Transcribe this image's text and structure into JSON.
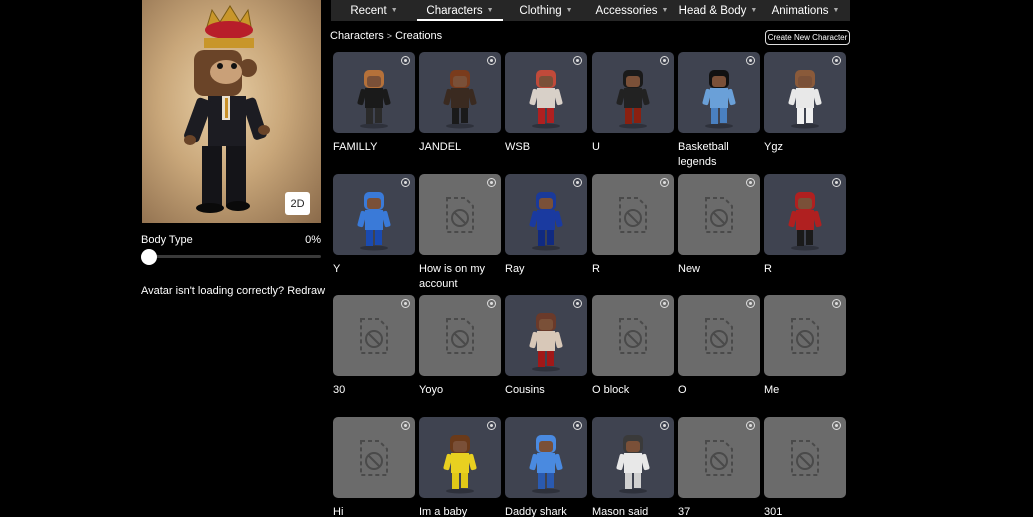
{
  "avatar_panel": {
    "toggle_label": "2D",
    "body_type_label": "Body Type",
    "body_type_value": "0%",
    "body_type_fraction": 0,
    "loading_text": "Avatar isn't loading correctly?",
    "redraw_label": "Redraw"
  },
  "nav": {
    "tabs": [
      {
        "label": "Recent"
      },
      {
        "label": "Characters"
      },
      {
        "label": "Clothing"
      },
      {
        "label": "Accessories"
      },
      {
        "label": "Head & Body"
      },
      {
        "label": "Animations"
      }
    ]
  },
  "breadcrumb": {
    "parent": "Characters",
    "current": "Creations"
  },
  "create_button": "Create New Character",
  "characters": [
    {
      "name": "FAMILLY",
      "thumb": "avatar",
      "hair": "#b5713a",
      "shirt": "#1a1a1a",
      "pants": "#2a2a2a"
    },
    {
      "name": "JANDEL",
      "thumb": "avatar",
      "hair": "#7a3b1c",
      "shirt": "#3a2a20",
      "pants": "#1a1a1a"
    },
    {
      "name": "WSB",
      "thumb": "avatar",
      "hair": "#c04a3a",
      "shirt": "#d8d0c8",
      "pants": "#b02020"
    },
    {
      "name": "U",
      "thumb": "avatar",
      "hair": "#1a1a1a",
      "shirt": "#222222",
      "pants": "#8a2010"
    },
    {
      "name": "Basketball legends",
      "thumb": "avatar",
      "hair": "#111111",
      "shirt": "#6aa0d8",
      "pants": "#4a80c0"
    },
    {
      "name": "Ygz",
      "thumb": "avatar",
      "hair": "#8a5a3a",
      "shirt": "#e8e8e8",
      "pants": "#f0f0f0"
    },
    {
      "name": "Y",
      "thumb": "avatar",
      "hair": "#3a7ad8",
      "shirt": "#3a7ad8",
      "pants": "#1a4ab0"
    },
    {
      "name": "How is on my account",
      "thumb": "empty"
    },
    {
      "name": "Ray",
      "thumb": "avatar",
      "hair": "#1a3a9a",
      "shirt": "#1a3aa0",
      "pants": "#102a80"
    },
    {
      "name": "R",
      "thumb": "empty"
    },
    {
      "name": "New",
      "thumb": "empty"
    },
    {
      "name": "R",
      "thumb": "avatar",
      "hair": "#b02020",
      "shirt": "#b02020",
      "pants": "#1a1a1a"
    },
    {
      "name": "30",
      "thumb": "empty"
    },
    {
      "name": "Yoyo",
      "thumb": "empty"
    },
    {
      "name": "Cousins",
      "thumb": "avatar",
      "hair": "#6a3a2a",
      "shirt": "#d8c8b8",
      "pants": "#a01818"
    },
    {
      "name": "O block",
      "thumb": "empty"
    },
    {
      "name": "O",
      "thumb": "empty"
    },
    {
      "name": "Me",
      "thumb": "empty"
    },
    {
      "name": "Hi",
      "thumb": "empty"
    },
    {
      "name": "Im a baby",
      "thumb": "avatar",
      "hair": "#6a3a1a",
      "shirt": "#e8d020",
      "pants": "#e0c818"
    },
    {
      "name": "Daddy shark",
      "thumb": "avatar",
      "hair": "#4a8ae0",
      "shirt": "#4a8ae0",
      "pants": "#2a5ab0"
    },
    {
      "name": "Mason said",
      "thumb": "avatar",
      "hair": "#3a3a3a",
      "shirt": "#e8e8e8",
      "pants": "#d0d0d0"
    },
    {
      "name": "37",
      "thumb": "empty"
    },
    {
      "name": "301",
      "thumb": "empty"
    }
  ]
}
